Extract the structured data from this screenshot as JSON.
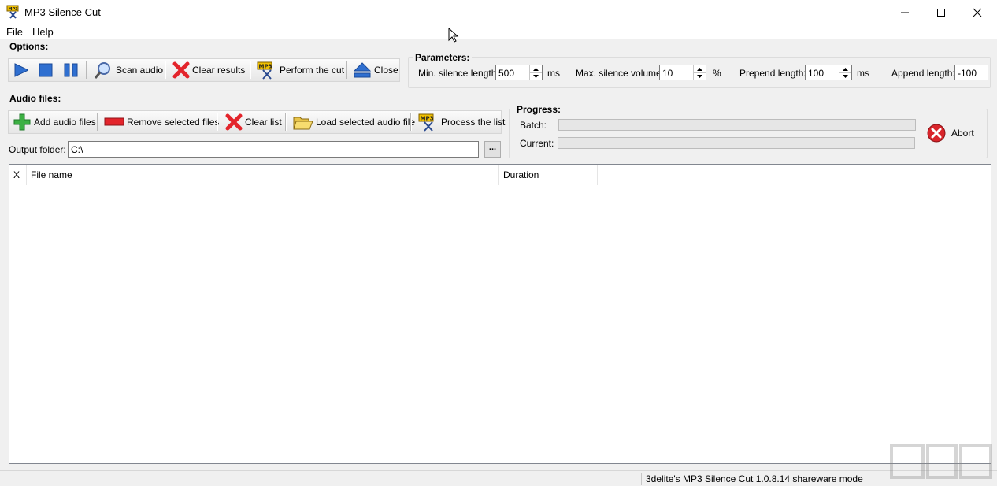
{
  "window": {
    "title": "MP3 Silence Cut"
  },
  "menu": {
    "file": "File",
    "help": "Help"
  },
  "options": {
    "label": "Options:",
    "toolbar": {
      "scan_audio": "Scan audio",
      "clear_results": "Clear results",
      "perform_cut": "Perform the cut",
      "close": "Close"
    }
  },
  "parameters": {
    "title": "Parameters:",
    "min_silence_label": "Min. silence length:",
    "min_silence_value": "500",
    "min_silence_unit": "ms",
    "max_volume_label": "Max. silence volume:",
    "max_volume_value": "10",
    "max_volume_unit": "%",
    "prepend_label": "Prepend length:",
    "prepend_value": "100",
    "prepend_unit": "ms",
    "append_label": "Append length:",
    "append_value": "-100"
  },
  "audio_files": {
    "label": "Audio files:",
    "toolbar": {
      "add": "Add audio files",
      "remove": "Remove selected files",
      "clear": "Clear list",
      "load": "Load selected audio file",
      "process": "Process the list"
    },
    "output_folder_label": "Output folder:",
    "output_folder_value": "C:\\",
    "browse_label": "..."
  },
  "progress": {
    "title": "Progress:",
    "batch_label": "Batch:",
    "current_label": "Current:",
    "batch_fraction": 0,
    "current_fraction": 0,
    "abort": "Abort"
  },
  "list": {
    "columns": [
      "X",
      "File name",
      "Duration"
    ]
  },
  "status": {
    "text": "3delite's MP3 Silence Cut 1.0.8.14 shareware mode"
  },
  "colors": {
    "play_blue": "#2f6fd0",
    "clear_red": "#e3242b",
    "add_green": "#3cb043"
  }
}
